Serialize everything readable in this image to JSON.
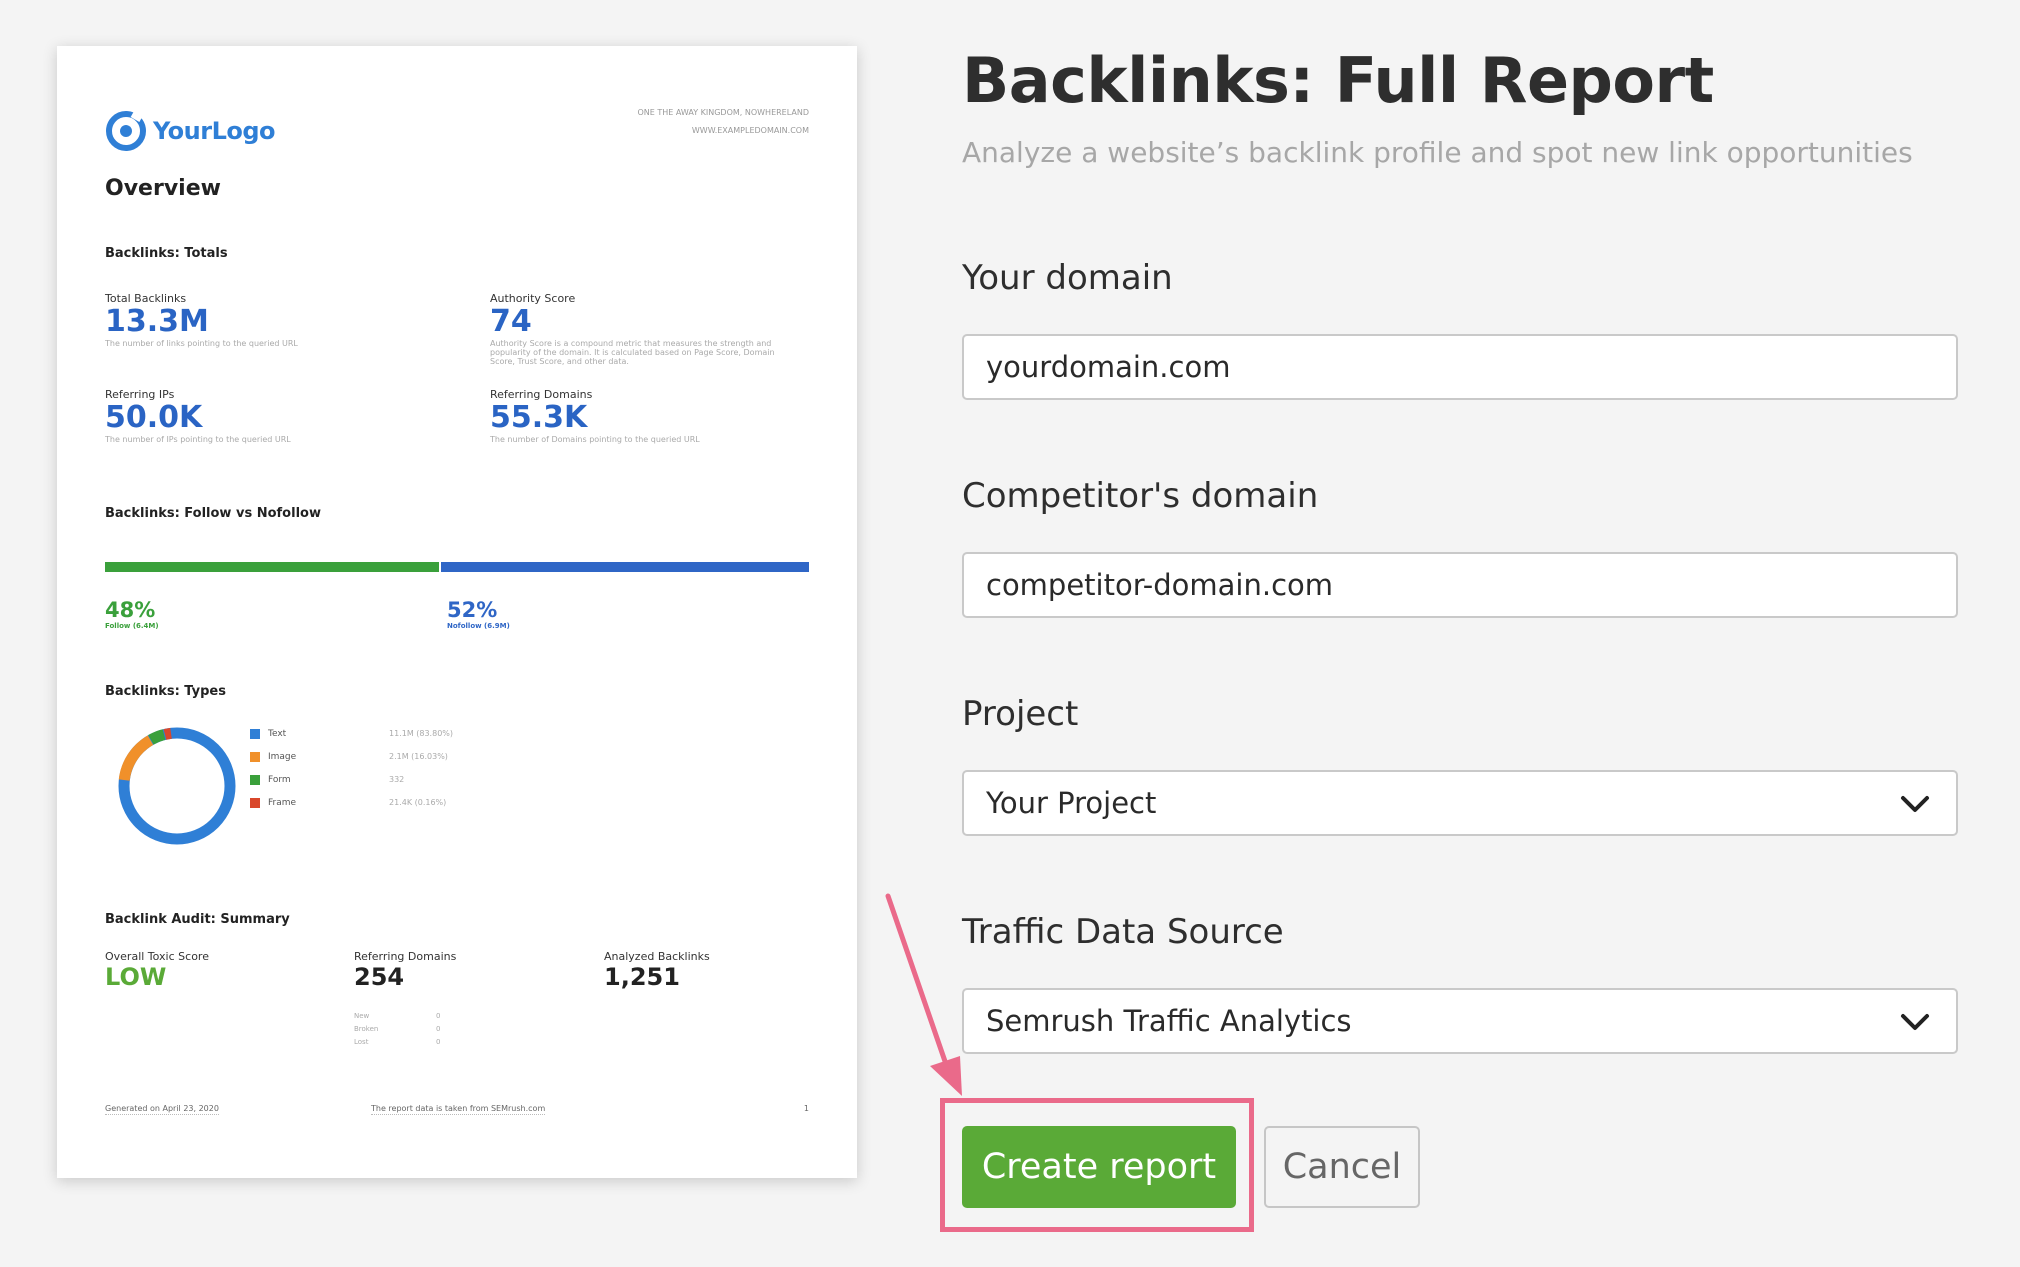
{
  "report_preview": {
    "logo_text": "YourLogo",
    "address_line1": "ONE THE AWAY KINGDOM, NOWHERELAND",
    "address_line2": "WWW.EXAMPLEDOMAIN.COM",
    "overview_title": "Overview",
    "totals_section": "Backlinks: Totals",
    "metrics": [
      {
        "label": "Total Backlinks",
        "value": "13.3M",
        "desc": "The number of links pointing to the queried URL"
      },
      {
        "label": "Authority Score",
        "value": "74",
        "desc": "Authority Score is a compound metric that measures the strength and popularity of the domain. It is calculated based on Page Score, Domain Score, Trust Score, and other data."
      },
      {
        "label": "Referring IPs",
        "value": "50.0K",
        "desc": "The number of IPs pointing to the queried URL"
      },
      {
        "label": "Referring Domains",
        "value": "55.3K",
        "desc": "The number of Domains pointing to the queried URL"
      }
    ],
    "follow_section": "Backlinks: Follow vs Nofollow",
    "follow": {
      "percent": "48%",
      "fraction": 0.48,
      "sub": "Follow (6.4M)",
      "color": "#3aa03b"
    },
    "nofollow": {
      "percent": "52%",
      "fraction": 0.52,
      "sub": "Nofollow (6.9M)",
      "color": "#2f66c6"
    },
    "types_section": "Backlinks: Types",
    "types": [
      {
        "name": "Text",
        "value": "11.1M (83.80%)",
        "color": "#2f7fd6",
        "share": 0.838
      },
      {
        "name": "Image",
        "value": "2.1M (16.03%)",
        "color": "#f0902a",
        "share": 0.1603
      },
      {
        "name": "Form",
        "value": "332",
        "color": "#3aa03b",
        "share": 0.0
      },
      {
        "name": "Frame",
        "value": "21.4K (0.16%)",
        "color": "#d9472b",
        "share": 0.0016
      }
    ],
    "audit_section": "Backlink Audit: Summary",
    "audit": [
      {
        "label": "Overall Toxic Score",
        "value": "LOW",
        "color": "#5aaa37"
      },
      {
        "label": "Referring Domains",
        "value": "254",
        "color": "#222222"
      },
      {
        "label": "Analyzed Backlinks",
        "value": "1,251",
        "color": "#222222"
      }
    ],
    "audit_breakdown": [
      {
        "label": "New",
        "value": "0"
      },
      {
        "label": "Broken",
        "value": "0"
      },
      {
        "label": "Lost",
        "value": "0"
      }
    ],
    "footer_left": "Generated on April 23, 2020",
    "footer_mid": "The report data is taken from SEMrush.com",
    "footer_page": "1"
  },
  "form": {
    "title": "Backlinks: Full Report",
    "subtitle": "Analyze a website’s backlink profile and spot new link opportunities",
    "your_domain_label": "Your domain",
    "your_domain_value": "yourdomain.com",
    "competitor_label": "Competitor's domain",
    "competitor_value": "competitor-domain.com",
    "project_label": "Project",
    "project_value": "Your Project",
    "traffic_label": "Traffic Data Source",
    "traffic_value": "Semrush Traffic Analytics",
    "create_button": "Create report",
    "cancel_button": "Cancel",
    "accent_green": "#5aaa37",
    "highlight_color": "#ea6a8a"
  }
}
